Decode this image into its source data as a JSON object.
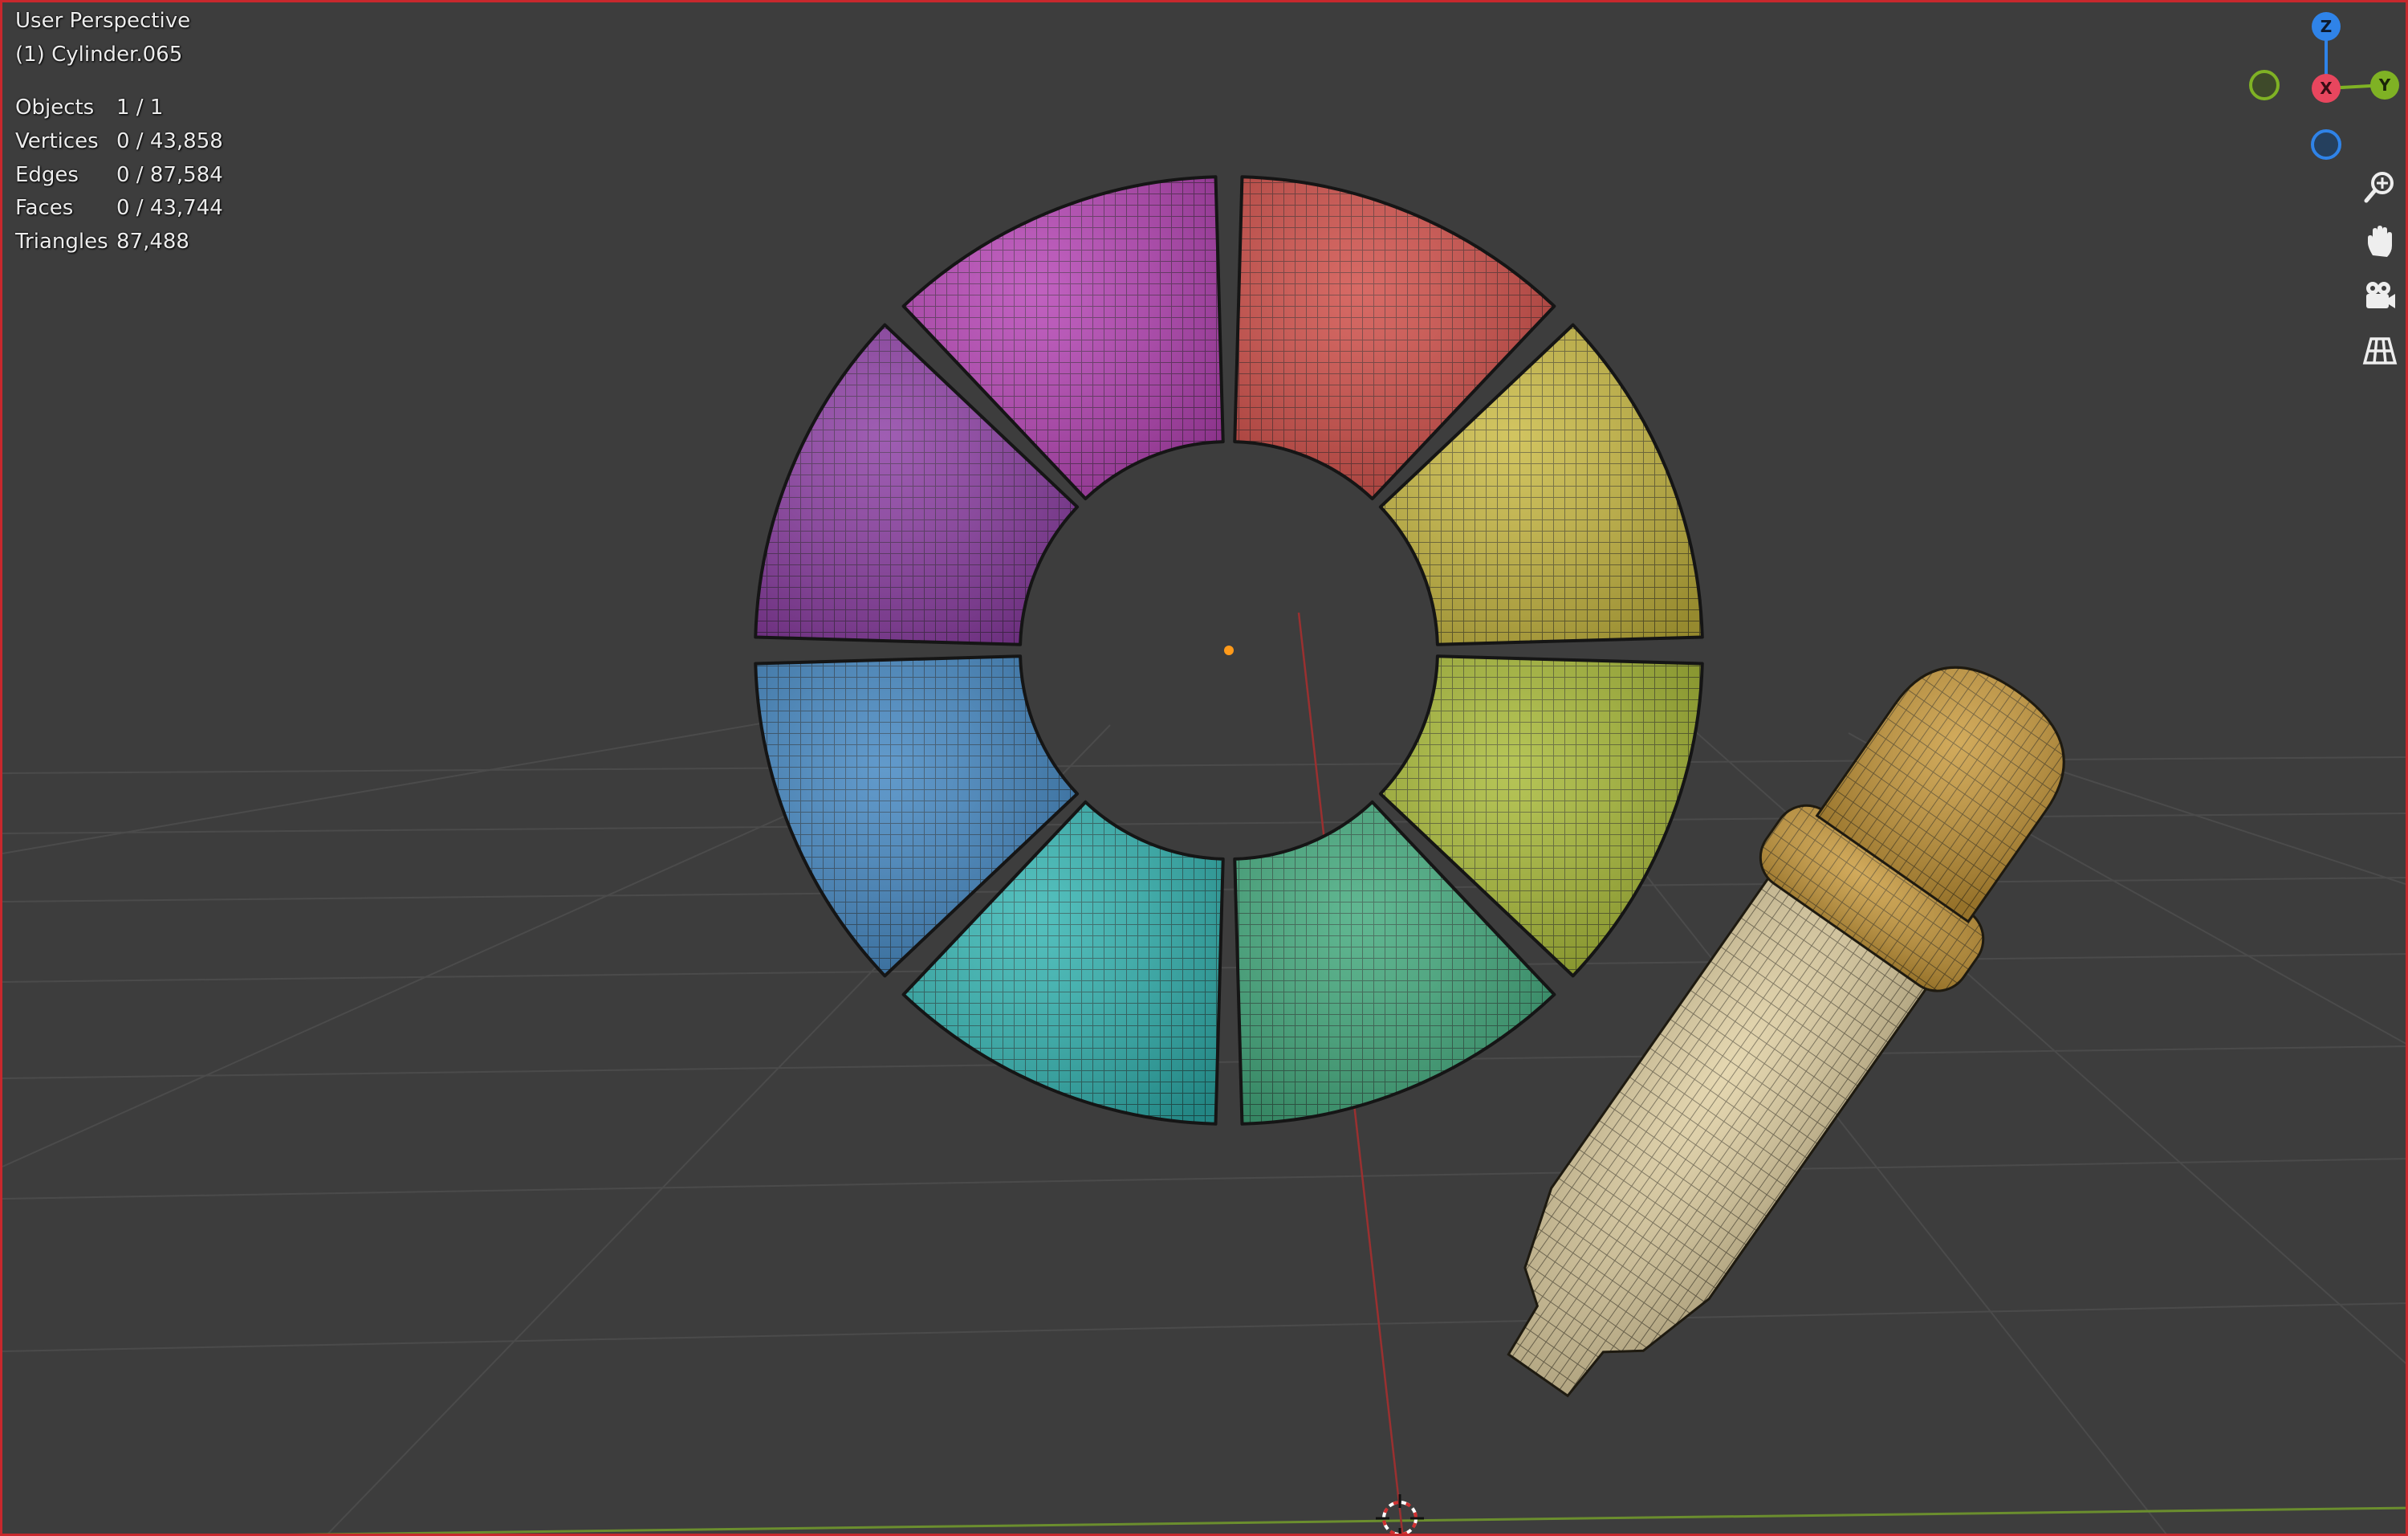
{
  "viewport": {
    "view_name": "User Perspective",
    "active_object": "(1) Cylinder.065"
  },
  "stats": [
    {
      "label": "Objects",
      "value": "1 / 1"
    },
    {
      "label": "Vertices",
      "value": "0 / 43,858"
    },
    {
      "label": "Edges",
      "value": "0 / 87,584"
    },
    {
      "label": "Faces",
      "value": "0 / 43,744"
    },
    {
      "label": "Triangles",
      "value": "87,488"
    }
  ],
  "gizmo": {
    "z_label": "Z",
    "y_label": "Y",
    "x_label": "X",
    "colors": {
      "x": "#e8465e",
      "y": "#7fb224",
      "z": "#2f83e8"
    }
  },
  "nav_icons": [
    "zoom-icon",
    "hand-pan-icon",
    "camera-icon",
    "grid-ortho-icon"
  ],
  "color_wheel_segments": [
    {
      "name": "red",
      "color": "#cf4a44"
    },
    {
      "name": "yellow",
      "color": "#c8b83e"
    },
    {
      "name": "yellow-green",
      "color": "#a6b832"
    },
    {
      "name": "green",
      "color": "#3ea87a"
    },
    {
      "name": "teal",
      "color": "#2fb3b0"
    },
    {
      "name": "blue",
      "color": "#3f84c0"
    },
    {
      "name": "purple",
      "color": "#8a3aa2"
    },
    {
      "name": "magenta",
      "color": "#b43fb3"
    }
  ],
  "colors": {
    "background": "#3d3d3d",
    "border": "#c8282d",
    "dropper_bulb": "#c89838",
    "dropper_body": "#e0cfa0"
  }
}
